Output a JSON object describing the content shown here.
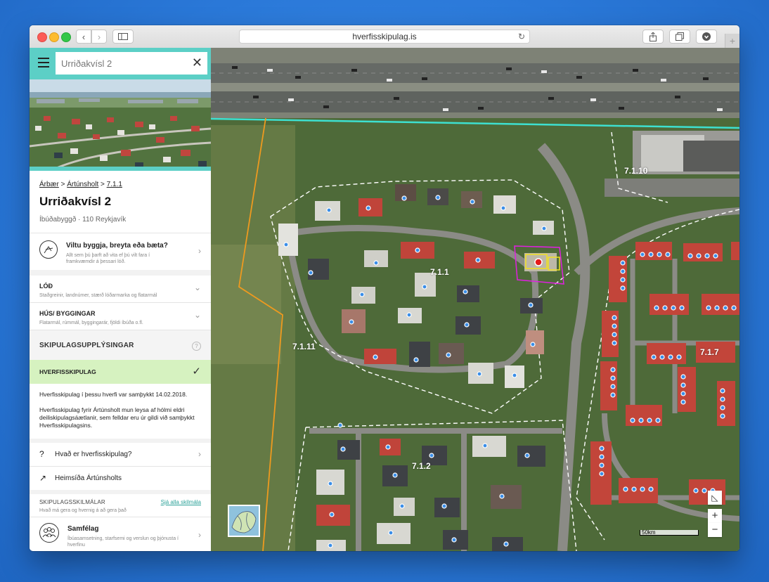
{
  "browser": {
    "url": "hverfisskipulag.is"
  },
  "search": {
    "value": "Urriðakvísl 2"
  },
  "breadcrumb": [
    "Árbær",
    "Ártúnsholt",
    "7.1.1"
  ],
  "place": {
    "title": "Urriðakvísl 2",
    "subtitle": "Íbúðabyggð · 110 Reykjavík"
  },
  "build_prompt": {
    "title": "Viltu byggja, breyta eða bæta?",
    "desc_line1": "Allt sem þú þarft að vita ef þú vilt fara í",
    "desc_line2": "framkvæmdir á þessari lóð."
  },
  "accordions": [
    {
      "title": "LÓÐ",
      "desc": "Staðgreinir, landnúmer, stærð lóðarmarka og flatarmál"
    },
    {
      "title": "HÚS/ BYGGINGAR",
      "desc": "Flatarmál, rúmmál, byggingarár, fjöldi íbúða o.fl."
    }
  ],
  "planning_section": {
    "heading": "SKIPULAGSUPPLÝSINGAR",
    "help": "?",
    "active_item": "HVERFISSKIPULAG",
    "text1": "Hverfisskipulag í þessu hverfi var samþykkt 14.02.2018.",
    "text2": "Hverfisskipulag fyrir Ártúnsholt mun leysa af hólmi eldri deiliskipulagsáætlanir, sem felldar eru úr gildi við samþykkt Hverfisskipulagsins."
  },
  "links": [
    {
      "icon": "?",
      "label": "Hvað er hverfisskipulag?"
    },
    {
      "icon": "↗",
      "label": "Heimsíða Ártúnsholts"
    }
  ],
  "terms": {
    "heading": "SKIPULAGSSKILMÁLAR",
    "see_all": "Sjá alla skilmála",
    "desc": "Hvað má gera og hvernig á að gera það",
    "item_title": "Samfélag",
    "item_desc_line1": "Íbúasamsetning, starfsemi og verslun og þjónusta í",
    "item_desc_line2": "hverfinu"
  },
  "map": {
    "zones": [
      "7.1.10",
      "7.1.1",
      "7.1.11",
      "7.1.7",
      "7.1.2"
    ],
    "scale": "50km",
    "zoom_in": "+",
    "zoom_out": "−",
    "measure": "◺"
  }
}
